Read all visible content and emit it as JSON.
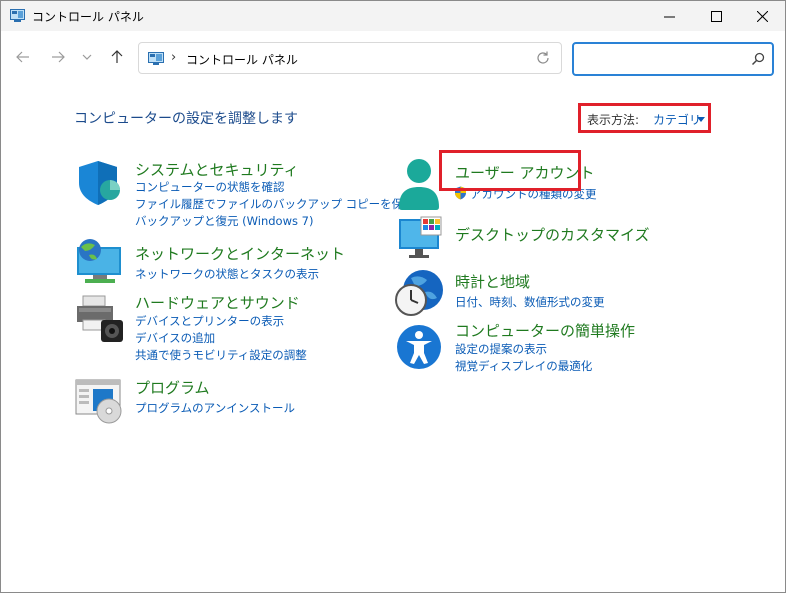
{
  "window": {
    "title": "コントロール パネル"
  },
  "address": {
    "separator": "›",
    "path": "コントロール パネル"
  },
  "search": {
    "placeholder": ""
  },
  "main": {
    "heading": "コンピューターの設定を調整します",
    "view_by_label": "表示方法:",
    "view_by_value": "カテゴリ"
  },
  "categories": {
    "system": {
      "title": "システムとセキュリティ",
      "links": [
        "コンピューターの状態を確認",
        "ファイル履歴でファイルのバックアップ コピーを保存",
        "バックアップと復元 (Windows 7)"
      ]
    },
    "network": {
      "title": "ネットワークとインターネット",
      "links": [
        "ネットワークの状態とタスクの表示"
      ]
    },
    "hardware": {
      "title": "ハードウェアとサウンド",
      "links": [
        "デバイスとプリンターの表示",
        "デバイスの追加",
        "共通で使うモビリティ設定の調整"
      ]
    },
    "programs": {
      "title": "プログラム",
      "links": [
        "プログラムのアンインストール"
      ]
    },
    "user": {
      "title": "ユーザー アカウント",
      "links": [
        "アカウントの種類の変更"
      ]
    },
    "appearance": {
      "title": "デスクトップのカスタマイズ",
      "links": []
    },
    "clock": {
      "title": "時計と地域",
      "links": [
        "日付、時刻、数値形式の変更"
      ]
    },
    "ease": {
      "title": "コンピューターの簡単操作",
      "links": [
        "設定の提案の表示",
        "視覚ディスプレイの最適化"
      ]
    }
  },
  "colors": {
    "category_title": "#1f7a1f",
    "link": "#0a5bb5",
    "heading": "#1c4b8c",
    "highlight": "#e0202a",
    "search_border": "#2a82d6"
  }
}
